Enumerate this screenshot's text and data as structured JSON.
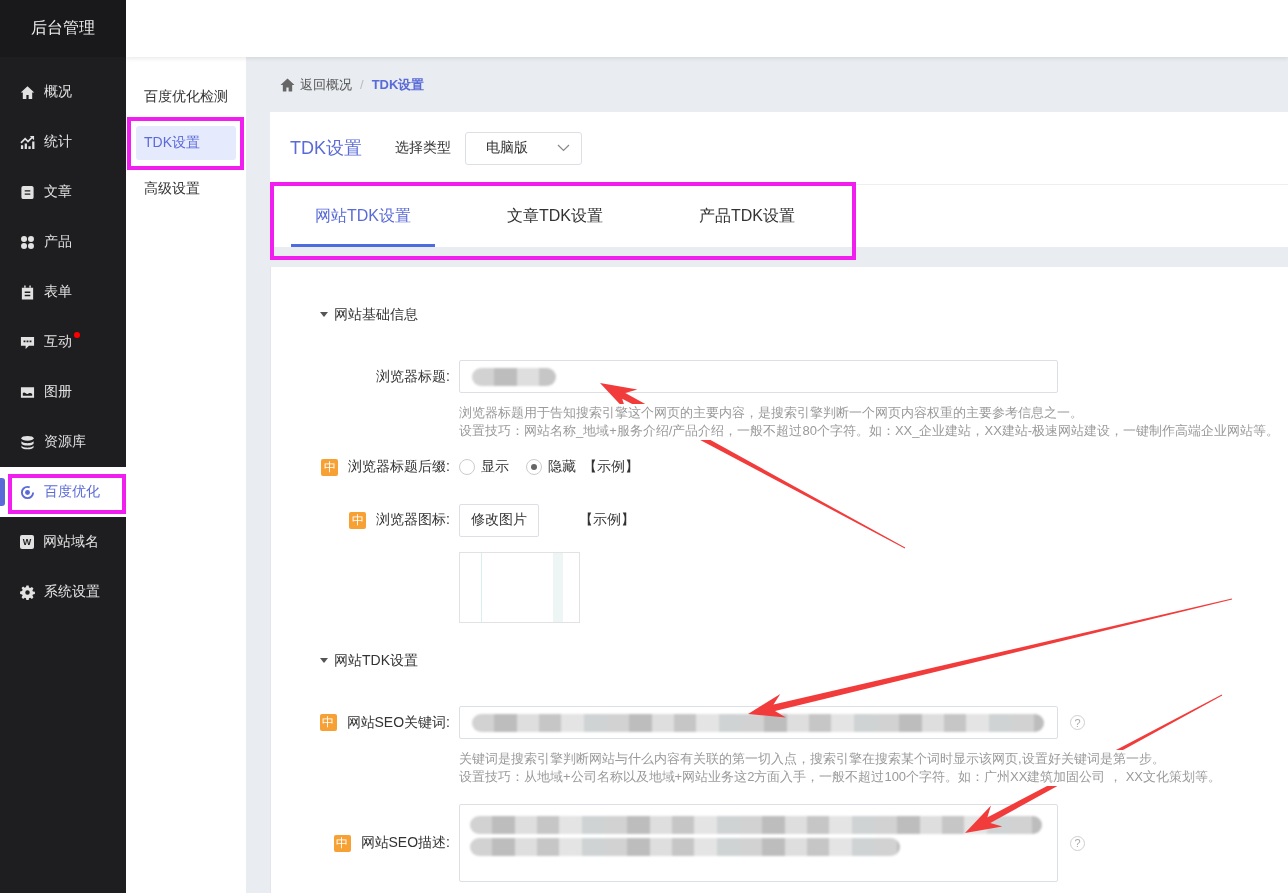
{
  "sidebar": {
    "title": "后台管理",
    "items": [
      {
        "label": "概况",
        "selected": false,
        "dot": false,
        "highlighted": false
      },
      {
        "label": "统计",
        "selected": false,
        "dot": false,
        "highlighted": false
      },
      {
        "label": "文章",
        "selected": false,
        "dot": false,
        "highlighted": false
      },
      {
        "label": "产品",
        "selected": false,
        "dot": false,
        "highlighted": false
      },
      {
        "label": "表单",
        "selected": false,
        "dot": false,
        "highlighted": false
      },
      {
        "label": "互动",
        "selected": false,
        "dot": true,
        "highlighted": false
      },
      {
        "label": "图册",
        "selected": false,
        "dot": false,
        "highlighted": false
      },
      {
        "label": "资源库",
        "selected": false,
        "dot": false,
        "highlighted": false
      },
      {
        "label": "百度优化",
        "selected": true,
        "dot": false,
        "highlighted": true
      },
      {
        "label": "网站域名",
        "selected": false,
        "dot": false,
        "highlighted": false,
        "icon_letter": "W"
      },
      {
        "label": "系统设置",
        "selected": false,
        "dot": false,
        "highlighted": false
      }
    ]
  },
  "subnav": {
    "items": [
      {
        "label": "百度优化检测",
        "selected": false,
        "highlighted": false
      },
      {
        "label": "TDK设置",
        "selected": true,
        "highlighted": true
      },
      {
        "label": "高级设置",
        "selected": false,
        "highlighted": false
      }
    ]
  },
  "breadcrumb": {
    "items": [
      {
        "label": "返回概况",
        "current": false
      },
      {
        "label": "TDK设置",
        "current": true
      }
    ],
    "separator": "/"
  },
  "page_header": {
    "title": "TDK设置",
    "type_label": "选择类型",
    "type_select": "电脑版"
  },
  "tabs": {
    "highlighted": true,
    "items": [
      {
        "label": "网站TDK设置",
        "selected": true
      },
      {
        "label": "文章TDK设置",
        "selected": false
      },
      {
        "label": "产品TDK设置",
        "selected": false
      }
    ]
  },
  "form": {
    "annotation_arrows": true,
    "sections": [
      {
        "title": "网站基础信息",
        "expanded": true,
        "rows": [
          {
            "kind": "input",
            "label": "浏览器标题:",
            "redacted": true,
            "help": [
              "浏览器标题用于告知搜索引擎这个网页的主要内容，是搜索引擎判断一个网页内容权重的主要参考信息之一。",
              "设置技巧：网站名称_地域+服务介绍/产品介绍，一般不超过80个字符。如：XX_企业建站，XX建站-极速网站建设，一键制作高端企业网站等。"
            ]
          },
          {
            "kind": "radio",
            "badge": "中",
            "label": "浏览器标题后缀:",
            "options": [
              {
                "label": "显示",
                "selected": false
              },
              {
                "label": "隐藏",
                "selected": true
              }
            ],
            "link": "【示例】"
          },
          {
            "kind": "upload",
            "badge": "中",
            "label": "浏览器图标:",
            "button": "修改图片",
            "link": "【示例】",
            "preview": true
          }
        ]
      },
      {
        "title": "网站TDK设置",
        "expanded": true,
        "rows": [
          {
            "kind": "input",
            "badge": "中",
            "label": "网站SEO关键词:",
            "redacted": true,
            "help_mark": "?",
            "help": [
              "关键词是搜索引擎判断网站与什么内容有关联的第一切入点，搜索引擎在搜索某个词时显示该网页,设置好关键词是第一步。",
              "设置技巧：从地域+公司名称以及地域+网站业务这2方面入手，一般不超过100个字符。如：广州XX建筑加固公司 ， XX文化策划等。"
            ]
          },
          {
            "kind": "textarea",
            "badge": "中",
            "label": "网站SEO描述:",
            "redacted": true,
            "help_mark": "?"
          }
        ]
      }
    ]
  }
}
